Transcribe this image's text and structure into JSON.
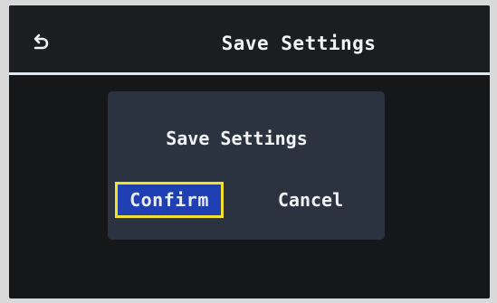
{
  "header": {
    "title": "Save Settings",
    "back_icon": "back-arrow-icon"
  },
  "dialog": {
    "title": "Save Settings",
    "confirm_label": "Confirm",
    "cancel_label": "Cancel",
    "focused_button": "confirm"
  },
  "colors": {
    "screen_background": "#161719",
    "dialog_background": "#2c3340",
    "confirm_background": "#1f3fb3",
    "focus_border": "#f3e22b",
    "divider": "#dfe9ee",
    "text": "#f2f4f6"
  }
}
